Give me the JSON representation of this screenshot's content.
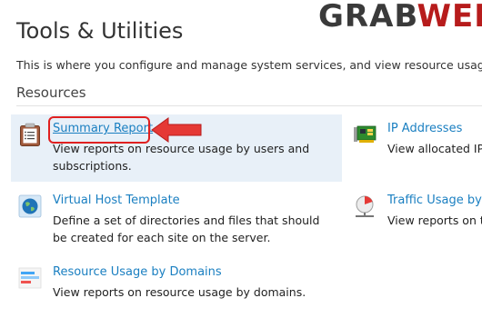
{
  "page": {
    "title": "Tools & Utilities",
    "description": "This is where you configure and manage system services, and view resource usage st"
  },
  "watermark": {
    "part1": "GRAB",
    "part2": "WEB"
  },
  "resources": {
    "title": "Resources",
    "items": [
      {
        "icon": "clipboard-report-icon",
        "label": "Summary Report",
        "text": "View reports on resource usage by users and subscriptions."
      },
      {
        "icon": "network-card-icon",
        "label": "IP Addresses",
        "text": "View allocated IP"
      },
      {
        "icon": "globe-icon",
        "label": "Virtual Host Template",
        "text": "Define a set of directories and files that should be created for each site on the server."
      },
      {
        "icon": "traffic-pie-icon",
        "label": "Traffic Usage by C",
        "text": "View reports on t"
      },
      {
        "icon": "usage-bars-icon",
        "label": "Resource Usage by Domains",
        "text": "View reports on resource usage by domains."
      }
    ]
  },
  "colors": {
    "link": "#1a7fc1",
    "highlight_bg": "#e8f0f8",
    "annotation_red": "#e02020",
    "watermark_dark": "#3a3a3a",
    "watermark_red": "#b71c1c"
  }
}
